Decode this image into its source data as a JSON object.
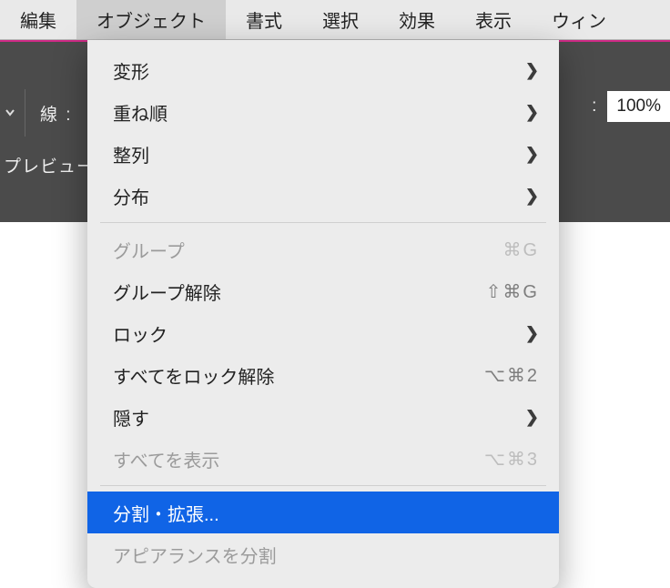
{
  "menubar": {
    "items": [
      {
        "label": "編集"
      },
      {
        "label": "オブジェクト"
      },
      {
        "label": "書式"
      },
      {
        "label": "選択"
      },
      {
        "label": "効果"
      },
      {
        "label": "表示"
      },
      {
        "label": "ウィン"
      }
    ],
    "active_index": 1
  },
  "appband": {
    "stroke_label": "線 :",
    "opacity_colon": ":",
    "opacity_value": "100%",
    "preview_label": "プレビュー"
  },
  "dropdown": {
    "groups": [
      [
        {
          "label": "変形",
          "submenu": true,
          "disabled": false
        },
        {
          "label": "重ね順",
          "submenu": true,
          "disabled": false
        },
        {
          "label": "整列",
          "submenu": true,
          "disabled": false
        },
        {
          "label": "分布",
          "submenu": true,
          "disabled": false
        }
      ],
      [
        {
          "label": "グループ",
          "shortcut": "⌘G",
          "disabled": true
        },
        {
          "label": "グループ解除",
          "shortcut": "⇧⌘G",
          "disabled": false
        },
        {
          "label": "ロック",
          "submenu": true,
          "disabled": false
        },
        {
          "label": "すべてをロック解除",
          "shortcut": "⌥⌘2",
          "disabled": false
        },
        {
          "label": "隠す",
          "submenu": true,
          "disabled": false
        },
        {
          "label": "すべてを表示",
          "shortcut": "⌥⌘3",
          "disabled": true
        }
      ],
      [
        {
          "label": "分割・拡張...",
          "selected": true,
          "disabled": false
        },
        {
          "label": "アピアランスを分割",
          "disabled": true
        }
      ]
    ]
  }
}
